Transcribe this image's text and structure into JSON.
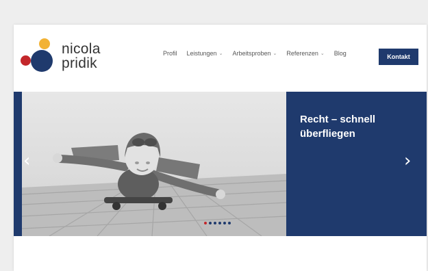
{
  "brand": {
    "line1": "nicola",
    "line2": "pridik",
    "colors": {
      "yellow": "#f2b234",
      "red": "#c3272b",
      "blue": "#1f3a6d"
    }
  },
  "nav": {
    "items": [
      {
        "label": "Profil",
        "has_dropdown": false
      },
      {
        "label": "Leistungen",
        "has_dropdown": true
      },
      {
        "label": "Arbeitsproben",
        "has_dropdown": true
      },
      {
        "label": "Referenzen",
        "has_dropdown": true
      },
      {
        "label": "Blog",
        "has_dropdown": false
      }
    ],
    "cta_label": "Kontakt"
  },
  "slider": {
    "title_line1": "Recht – schnell",
    "title_line2": "überfliegen",
    "prev_icon": "‹",
    "next_icon": "›",
    "pagination_count": 6,
    "active_index": 0,
    "image_semantic": "child-pilot-on-skateboard-photo"
  }
}
